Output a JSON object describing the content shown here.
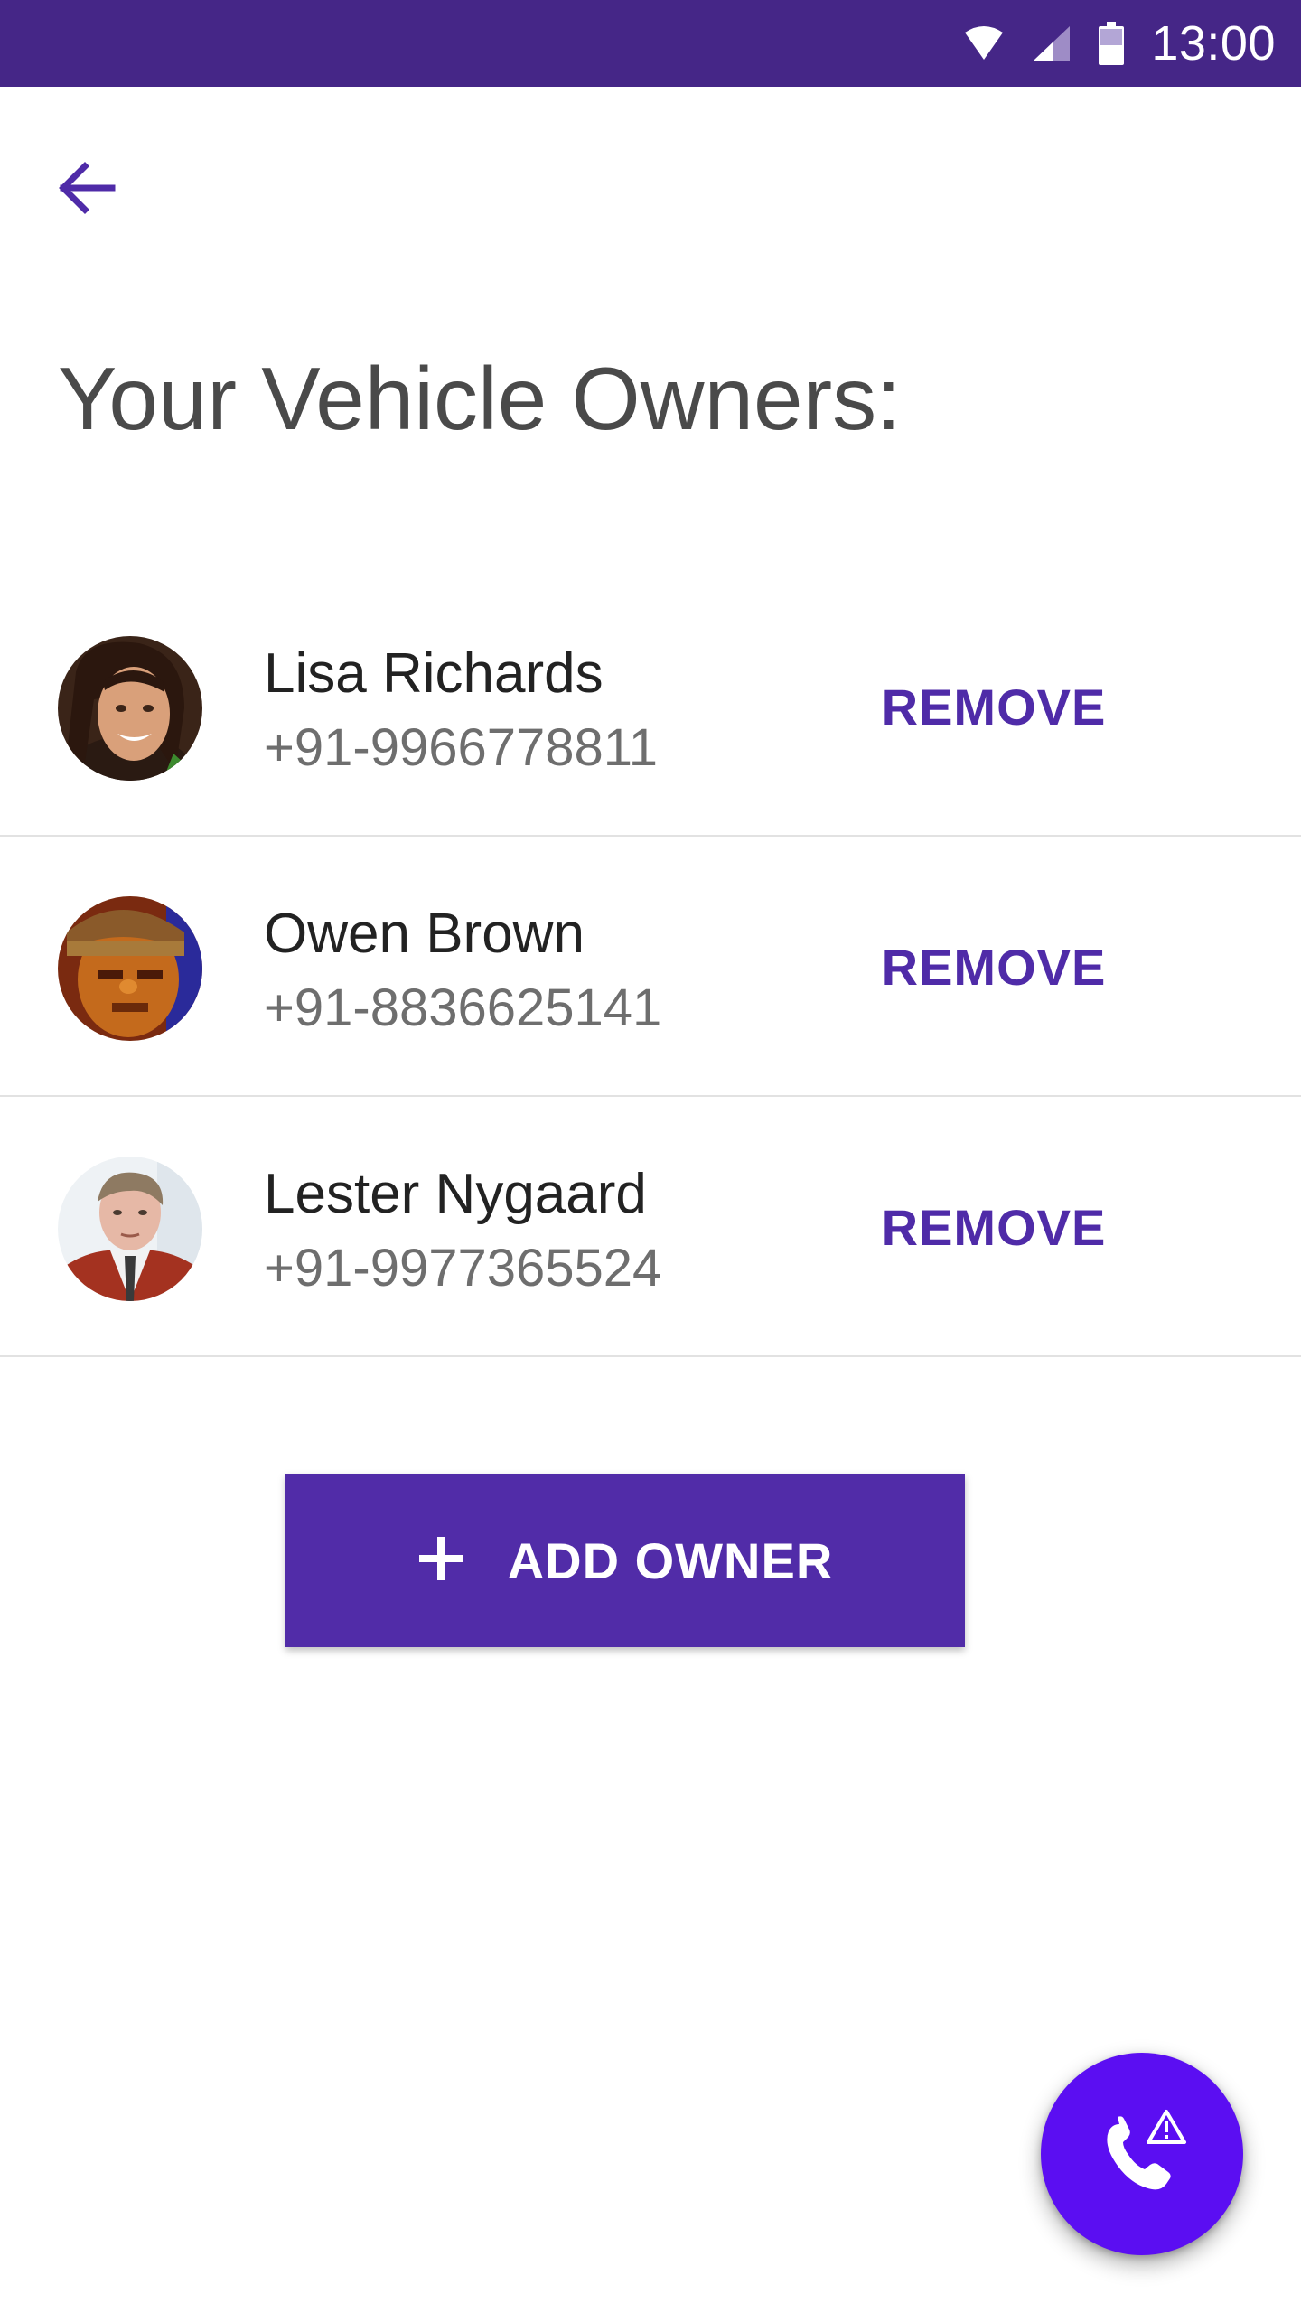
{
  "status_bar": {
    "time": "13:00",
    "icons": [
      "wifi-icon",
      "cellular-signal-icon",
      "battery-icon"
    ],
    "background": "#452687"
  },
  "header": {
    "back_icon": "arrow-back-icon",
    "title": "Your Vehicle Owners:"
  },
  "owners": [
    {
      "name": "Lisa Richards",
      "phone": "+91-9966778811",
      "remove_label": "REMOVE"
    },
    {
      "name": "Owen Brown",
      "phone": "+91-8836625141",
      "remove_label": "REMOVE"
    },
    {
      "name": "Lester Nygaard",
      "phone": "+91-9977365524",
      "remove_label": "REMOVE"
    }
  ],
  "add_owner": {
    "label": "ADD OWNER",
    "icon": "plus-icon"
  },
  "fab": {
    "icon": "phone-alert-icon"
  },
  "colors": {
    "accent": "#512ca8",
    "remove_text": "#4f2ba8",
    "fab": "#5b0ef2",
    "divider": "#e2e2e2"
  }
}
